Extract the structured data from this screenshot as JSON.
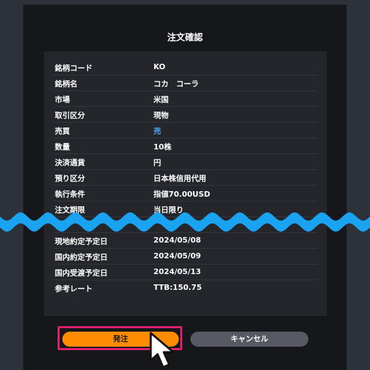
{
  "title": "注文確認",
  "rows": [
    {
      "label": "銘柄コード",
      "value": "KO"
    },
    {
      "label": "銘柄名",
      "value": "コカ　コーラ"
    },
    {
      "label": "市場",
      "value": "米国"
    },
    {
      "label": "取引区分",
      "value": "現物"
    },
    {
      "label": "売買",
      "value": "売"
    },
    {
      "label": "数量",
      "value": "10株"
    },
    {
      "label": "決済通貨",
      "value": "円"
    },
    {
      "label": "預り区分",
      "value": "日本株信用代用"
    },
    {
      "label": "執行条件",
      "value": "指値70.00USD"
    },
    {
      "label": "注文期限",
      "value": "当日限り"
    },
    {
      "label": "",
      "value": ""
    },
    {
      "label": "現地約定予定日",
      "value": "2024/05/08"
    },
    {
      "label": "国内約定予定日",
      "value": "2024/05/09"
    },
    {
      "label": "国内受渡予定日",
      "value": "2024/05/13"
    },
    {
      "label": "参考レート",
      "value": "TTB:150.75"
    }
  ],
  "buttons": {
    "submit": "発注",
    "cancel": "キャンセル"
  },
  "colors": {
    "submit_bg": "#ff8c00",
    "cancel_bg": "#575a63",
    "highlight_border": "#e21f6d",
    "sell_text": "#4aa8f0",
    "wave": "#1aa3f0"
  }
}
